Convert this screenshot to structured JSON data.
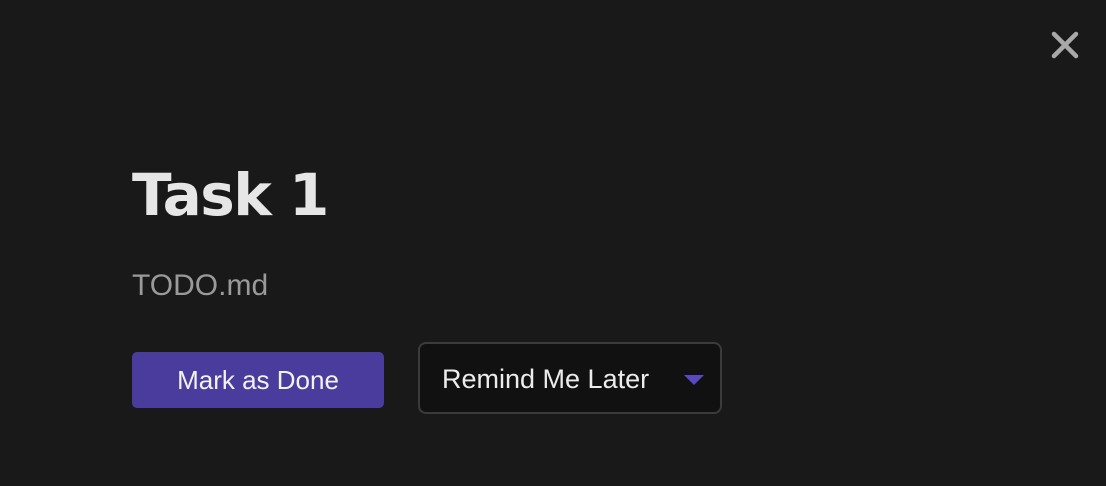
{
  "notification": {
    "title": "Task 1",
    "file": "TODO.md"
  },
  "actions": {
    "done_label": "Mark as Done",
    "remind_label": "Remind Me Later",
    "remind_icon": "chevron-down-icon",
    "close_icon": "close-icon"
  },
  "colors": {
    "background": "#191919",
    "accent": "#4a3c9c",
    "chevron": "#5a47c2",
    "title_text": "#e6e6e6",
    "secondary_text": "#9a9a9a"
  }
}
